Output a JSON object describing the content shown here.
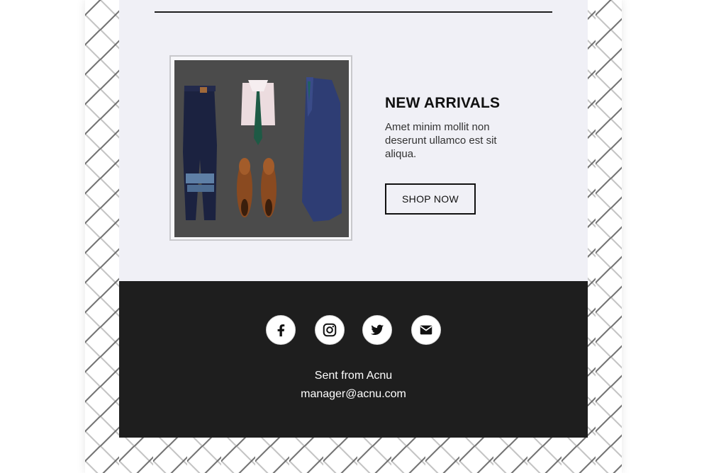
{
  "promo": {
    "title": "NEW ARRIVALS",
    "description": "Amet minim mollit non deserunt ullamco est sit aliqua.",
    "button_label": "SHOP NOW"
  },
  "social": {
    "icons": [
      "facebook-icon",
      "instagram-icon",
      "twitter-icon",
      "mail-icon"
    ]
  },
  "footer": {
    "sender": "Sent from Acnu",
    "email": "manager@acnu.com"
  },
  "colors": {
    "panel_background": "#f0f0f6",
    "footer_background": "#1e1e1e",
    "text_dark": "#111111"
  }
}
